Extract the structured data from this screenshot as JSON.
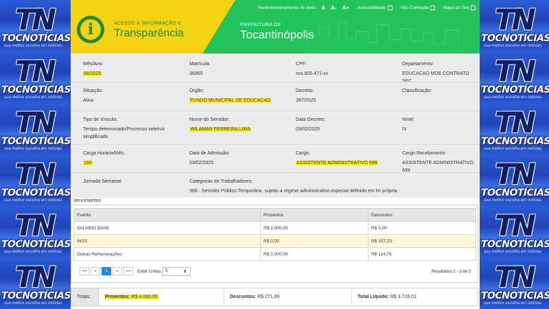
{
  "watermark": {
    "logo": "TN",
    "name": "TOCNOTÍCIAS",
    "tagline": "sua melhor escolha em notícias"
  },
  "header": {
    "brand_sub": "ACESSO À INFORMAÇÃO E",
    "brand_main": "Transparência",
    "logo_letter": "i",
    "pref_sub": "PREFEITURA DE",
    "pref_main": "Tocantinópolis",
    "topbar": {
      "resize": "Redimensionamento do texto",
      "a_normal": "A",
      "a_minus": "A-",
      "a_plus": "A+",
      "acess": "Acessibilidade",
      "contrast": "Alto Contraste",
      "sitemap": "Mapa do Site"
    },
    "colors": {
      "green": "#22c35a",
      "yellow": "#f4d312"
    }
  },
  "details": {
    "row1": {
      "mes_ano": {
        "label": "Mês/Ano:",
        "value": "06/2025"
      },
      "matricula": {
        "label": "Matrícula:",
        "value": "36965"
      },
      "cpf": {
        "label": "CPF:",
        "value": "xxx.605.471-xx"
      },
      "departamento": {
        "label": "Departamento:",
        "value": "EDUCACAO MDE CONTRATO SEC"
      }
    },
    "row2": {
      "situacao": {
        "label": "Situação:",
        "value": "Ativo"
      },
      "orgao": {
        "label": "Órgão:",
        "value": "FUNDO MUNICIPAL DE EDUCACAO"
      },
      "decreto": {
        "label": "Decreto:",
        "value": "287/2025"
      },
      "classificacao": {
        "label": "Classificação:",
        "value": ""
      }
    },
    "row3": {
      "tipo_vinculo": {
        "label": "Tipo de Vínculo:",
        "value": "Tempo determinado/Processo seletivo simplificado"
      },
      "nome": {
        "label": "Nome do Servidor:",
        "value": "WILAMAN FERREIRA LIMA"
      },
      "data_decreto": {
        "label": "Data Decreto:",
        "value": "03/02/2025"
      },
      "nivel": {
        "label": "Nível:",
        "value": "IV"
      }
    },
    "row4": {
      "carga": {
        "label": "Carga Horária/Mês:",
        "value": "160"
      },
      "admissao": {
        "label": "Data de Admissão:",
        "value": "03/02/2025"
      },
      "cargo": {
        "label": "Cargo:",
        "value": "ASSISTENTE ADMINISTRATIVO 699"
      },
      "cargo_rec": {
        "label": "Cargo Recebimento:",
        "value": "ASSISTENTE ADMINISTRATIVO 699"
      }
    },
    "row5": {
      "jornada": {
        "label": "Jornada Semanal:",
        "value": ""
      },
      "categorias": {
        "label": "Categorias de Trabalhadores:",
        "value": "306 - Servidor Público Temporário, sujeito a regime administrativo especial definido em lei própria"
      }
    }
  },
  "vencimentos": {
    "title": "Vencimentos",
    "headers": [
      "Evento",
      "Proventos",
      "Descontos"
    ],
    "rows": [
      [
        "SALARIO BASE",
        "R$ 2.000,00",
        "R$ 0,00"
      ],
      [
        "INSS",
        "R$ 0,00",
        "R$ 157,23"
      ],
      [
        "Outras Remunerações",
        "R$ 2.000,00",
        "R$ 114,76"
      ]
    ],
    "pager": {
      "first": "««",
      "prev": "«",
      "page": "1",
      "next": "»",
      "last": "»»"
    },
    "exibir_label": "Exibir Linhas",
    "rows_per_page": "5",
    "resultados": "Resultados 1 - 3 de 3"
  },
  "totals": {
    "label": "Totais:",
    "proventos_label": "Proventos:",
    "proventos_value": "R$ 4.000,00",
    "descontos_label": "Descontos:",
    "descontos_value": "R$ 271,99",
    "liquido_label": "Total Líquido:",
    "liquido_value": "R$ 3.728,01"
  }
}
